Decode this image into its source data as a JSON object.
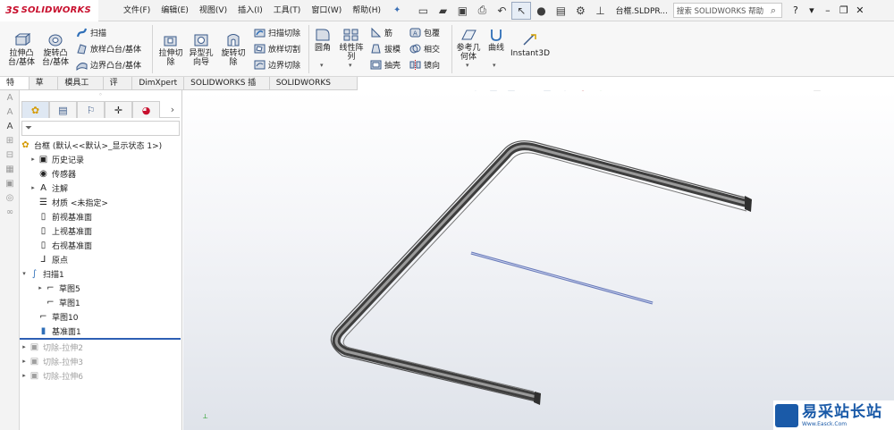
{
  "app": {
    "logo_mark": "3S",
    "logo_text": "SOLIDWORKS"
  },
  "menu": [
    "文件(F)",
    "编辑(E)",
    "视图(V)",
    "插入(I)",
    "工具(T)",
    "窗口(W)",
    "帮助(H)"
  ],
  "document": {
    "name": "台框.SLDPR..."
  },
  "search": {
    "placeholder": "搜索 SOLIDWORKS 帮助"
  },
  "ribbon": {
    "extrude_boss": "拉伸凸\n台/基体",
    "revolve_boss": "旋转凸\n台/基体",
    "sweep": "扫描",
    "loft_boss": "放样凸台/基体",
    "boundary_boss": "边界凸台/基体",
    "extrude_cut": "拉伸切\n除",
    "hole_wizard": "异型孔\n向导",
    "revolve_cut": "旋转切\n除",
    "swept_cut": "扫描切除",
    "lofted_cut": "放样切割",
    "boundary_cut": "边界切除",
    "fillet": "圆角",
    "linear_pattern": "线性阵\n列",
    "rib": "筋",
    "draft": "拔模",
    "shell": "抽壳",
    "wrap": "包覆",
    "intersect": "相交",
    "mirror": "镜向",
    "ref_geometry": "参考几\n何体",
    "curves": "曲线",
    "instant3d": "Instant3D"
  },
  "tabs": [
    "特征",
    "草图",
    "模具工具",
    "评估",
    "DimXpert",
    "SOLIDWORKS 插件",
    "SOLIDWORKS MBD"
  ],
  "feature_tree": {
    "root": "台框 (默认<<默认>_显示状态 1>)",
    "items": [
      {
        "label": "历史记录",
        "icon": "history-icon"
      },
      {
        "label": "传感器",
        "icon": "sensor-icon"
      },
      {
        "label": "注解",
        "icon": "annotation-icon"
      },
      {
        "label": "材质 <未指定>",
        "icon": "material-icon"
      },
      {
        "label": "前视基准面",
        "icon": "plane-icon"
      },
      {
        "label": "上视基准面",
        "icon": "plane-icon"
      },
      {
        "label": "右视基准面",
        "icon": "plane-icon"
      },
      {
        "label": "原点",
        "icon": "origin-icon"
      },
      {
        "label": "扫描1",
        "icon": "sweep-icon"
      },
      {
        "label": "草图5",
        "icon": "sketch-icon"
      },
      {
        "label": "草图1",
        "icon": "sketch-icon"
      },
      {
        "label": "草图10",
        "icon": "sketch-icon"
      },
      {
        "label": "基准面1",
        "icon": "plane-icon"
      },
      {
        "label": "切除-拉伸2",
        "icon": "cut-icon"
      },
      {
        "label": "切除-拉伸3",
        "icon": "cut-icon"
      },
      {
        "label": "切除-拉伸6",
        "icon": "cut-icon"
      }
    ]
  },
  "watermark": {
    "title": "易采站长站",
    "subtitle": "Www.Easck.Com"
  }
}
